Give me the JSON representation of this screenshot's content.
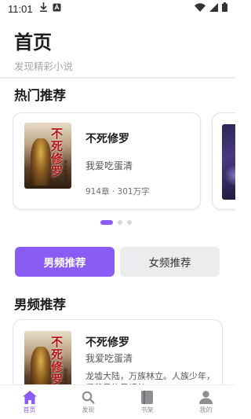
{
  "status_bar": {
    "time": "11:01"
  },
  "header": {
    "title": "首页",
    "subtitle": "发现精彩小说"
  },
  "hot": {
    "title": "热门推荐",
    "book": {
      "title": "不死修罗",
      "author": "我爱吃蛋清",
      "meta": "914章 · 301万字",
      "cover_text": "不死修罗",
      "cover_small": "我爱吃蛋清"
    },
    "pager": {
      "count": 3,
      "active": 0
    }
  },
  "tabs": {
    "male": "男频推荐",
    "female": "女频推荐",
    "active": "male"
  },
  "male_section": {
    "title": "男频推荐",
    "book": {
      "title": "不死修罗",
      "author": "我爱吃蛋清",
      "description": "龙墟大陆，万族林立。人族少年，偶获吴族君坦帅……"
    }
  },
  "nav": {
    "items": [
      {
        "label": "首页",
        "icon": "home-icon",
        "active": true
      },
      {
        "label": "发现",
        "icon": "search-icon",
        "active": false
      },
      {
        "label": "书架",
        "icon": "bookshelf-icon",
        "active": false
      },
      {
        "label": "我的",
        "icon": "profile-icon",
        "active": false
      }
    ]
  },
  "colors": {
    "accent": "#8a5cf5",
    "muted": "#a7a7ab",
    "tab_inactive_bg": "#ececef"
  }
}
